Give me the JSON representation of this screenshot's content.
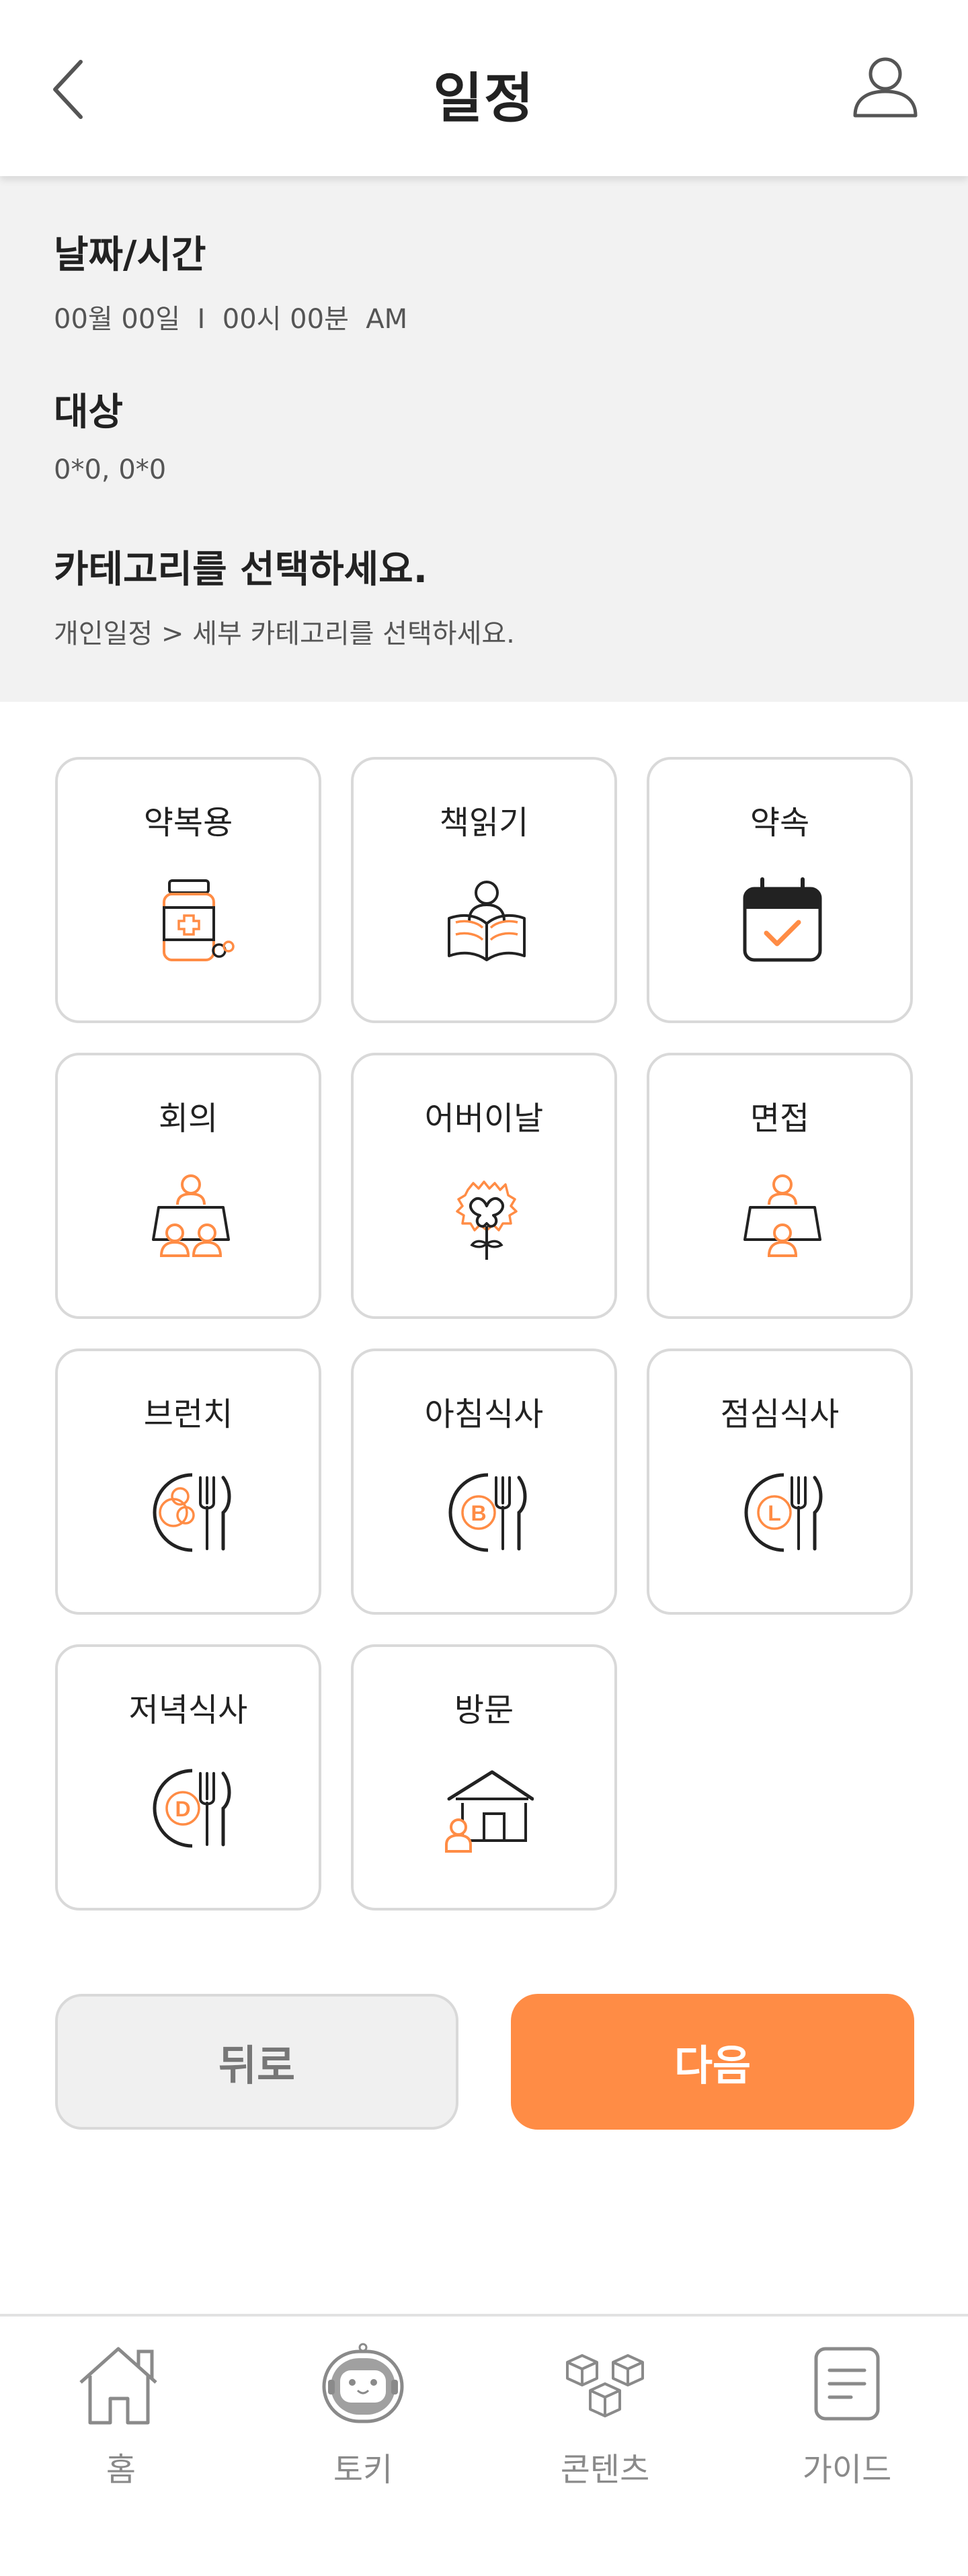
{
  "header": {
    "title": "일정",
    "back_icon": "chevron-left-icon",
    "profile_icon": "user-icon"
  },
  "info": {
    "datetime_label": "날짜/시간",
    "datetime_value": "00월 00일  I  00시 00분  AM",
    "target_label": "대상",
    "target_value": "0*0, 0*0",
    "category_label": "카테고리를 선택하세요.",
    "category_hint": "개인일정 > 세부 카테고리를 선택하세요."
  },
  "categories": [
    {
      "label": "약복용",
      "icon": "medicine-bottle-icon"
    },
    {
      "label": "책읽기",
      "icon": "reading-book-icon"
    },
    {
      "label": "약속",
      "icon": "calendar-check-icon"
    },
    {
      "label": "회의",
      "icon": "meeting-table-icon"
    },
    {
      "label": "어버이날",
      "icon": "carnation-bouquet-icon"
    },
    {
      "label": "면접",
      "icon": "interview-desk-icon"
    },
    {
      "label": "브런치",
      "icon": "brunch-plate-icon"
    },
    {
      "label": "아침식사",
      "icon": "breakfast-plate-icon"
    },
    {
      "label": "점심식사",
      "icon": "lunch-plate-icon"
    },
    {
      "label": "저녁식사",
      "icon": "dinner-plate-icon"
    },
    {
      "label": "방문",
      "icon": "house-visit-icon"
    }
  ],
  "buttons": {
    "back": "뒤로",
    "next": "다음"
  },
  "nav": [
    {
      "label": "홈",
      "icon": "home-icon"
    },
    {
      "label": "토키",
      "icon": "robot-icon"
    },
    {
      "label": "콘텐츠",
      "icon": "cubes-icon"
    },
    {
      "label": "가이드",
      "icon": "document-icon"
    }
  ],
  "colors": {
    "accent": "#ff8c45",
    "section_bg": "#f2f2f2",
    "border": "#d9d9d9"
  }
}
